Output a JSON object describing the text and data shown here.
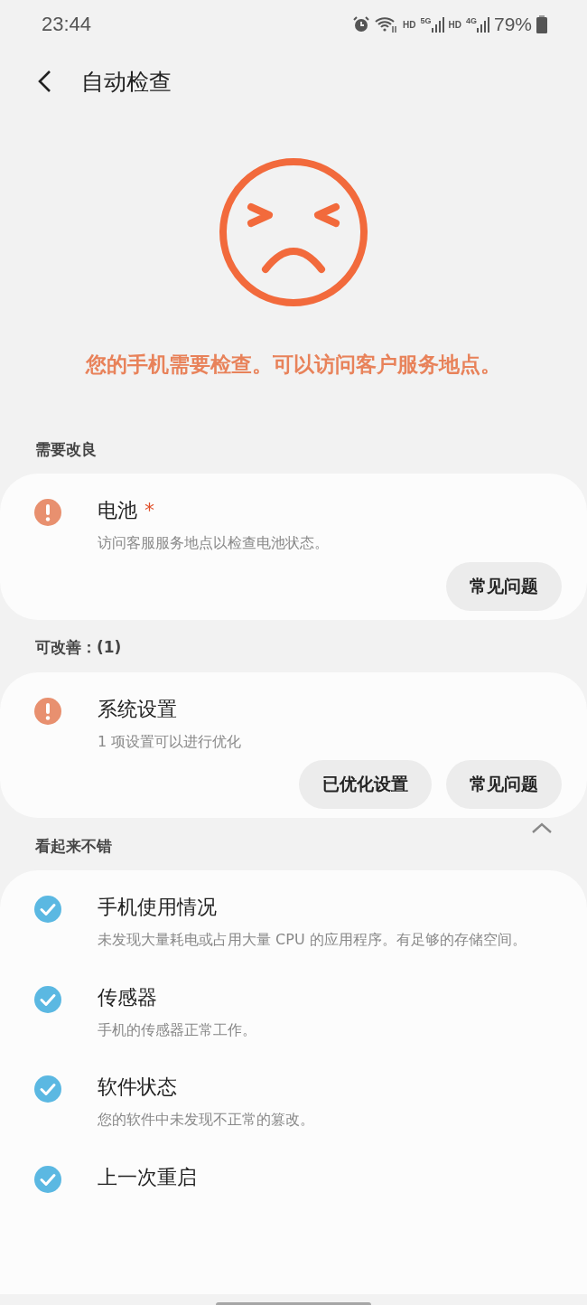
{
  "status_bar": {
    "time": "23:44",
    "hd_1": "HD",
    "network_1": "5G",
    "hd_2": "HD",
    "network_2": "4G",
    "battery": "79%"
  },
  "header": {
    "title": "自动检查"
  },
  "result": {
    "message": "您的手机需要检查。可以访问客户服务地点。"
  },
  "sections": [
    {
      "title": "需要改良",
      "items": [
        {
          "kind": "warning",
          "title": "电池",
          "badge": "*",
          "subtitle": "访问客服服务地点以检查电池状态。",
          "buttons": [
            "常见问题"
          ]
        }
      ]
    },
    {
      "title": "可改善：(1)",
      "items": [
        {
          "kind": "warning",
          "title": "系统设置",
          "subtitle": "1 项设置可以进行优化",
          "buttons": [
            "已优化设置",
            "常见问题"
          ]
        }
      ]
    },
    {
      "title": "看起来不错",
      "expanded": true,
      "items": [
        {
          "kind": "ok",
          "title": "手机使用情况",
          "subtitle": "未发现大量耗电或占用大量 CPU 的应用程序。有足够的存储空间。"
        },
        {
          "kind": "ok",
          "title": "传感器",
          "subtitle": "手机的传感器正常工作。"
        },
        {
          "kind": "ok",
          "title": "软件状态",
          "subtitle": "您的软件中未发现不正常的篡改。"
        },
        {
          "kind": "ok",
          "title": "上一次重启"
        }
      ]
    }
  ]
}
